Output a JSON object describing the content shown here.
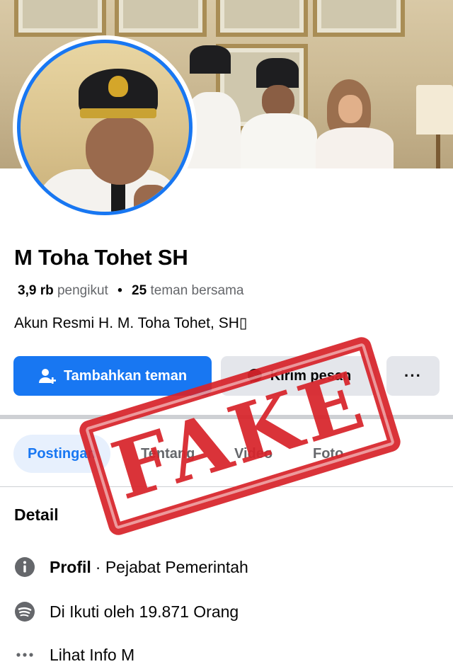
{
  "profile": {
    "name": "M Toha Tohet SH",
    "followers_count": "3,9 rb",
    "followers_label": "pengikut",
    "mutual_count": "25",
    "mutual_label": "teman bersama",
    "bio": "Akun Resmi H. M. Toha Tohet, SH▯"
  },
  "actions": {
    "add_friend": "Tambahkan teman",
    "message": "Kirim pesan",
    "more": "···"
  },
  "tabs": [
    {
      "label": "Postingan"
    },
    {
      "label": "Tentang"
    },
    {
      "label": "Video"
    },
    {
      "label": "Foto"
    }
  ],
  "details": {
    "heading": "Detail",
    "profile_label": "Profil",
    "profile_value": "· Pejabat Pemerintah",
    "followed_text": "Di Ikuti oleh 19.871 Orang",
    "see_info": "Lihat Info M"
  },
  "overlay": {
    "stamp_text": "FAKE"
  },
  "colors": {
    "accent": "#1877f2",
    "stamp": "#d8242b",
    "button_gray": "#e4e6eb",
    "muted_text": "#65676b"
  },
  "icons": {
    "add_friend": "person-add-icon",
    "message": "messenger-icon",
    "profile": "info-icon",
    "followed": "followers-icon",
    "see_info": "more-dots-icon"
  }
}
